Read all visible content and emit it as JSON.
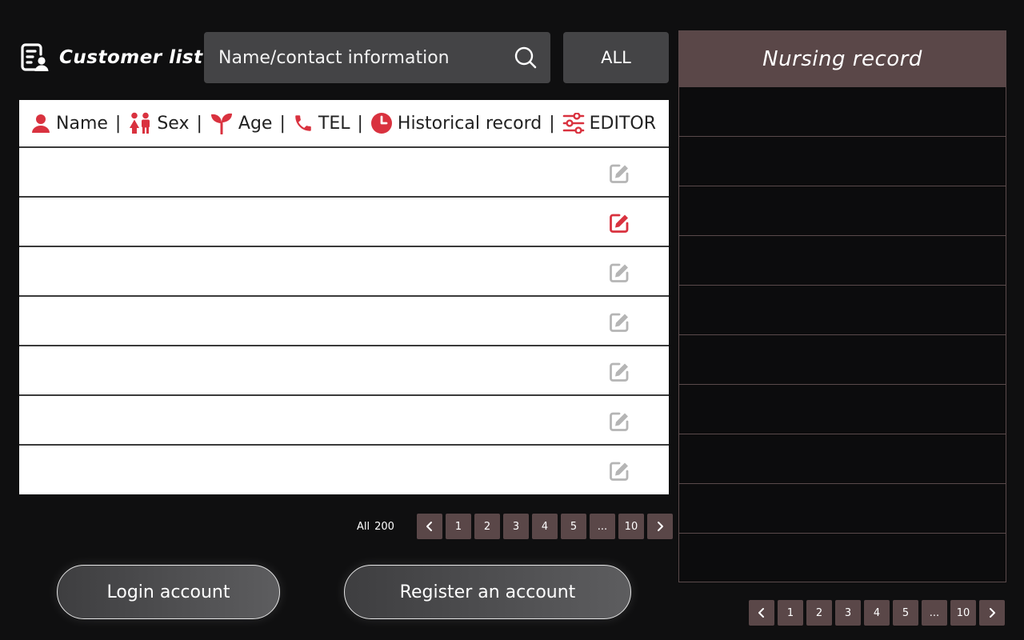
{
  "header": {
    "title": "Customer list",
    "title_icon": "customer-list-icon"
  },
  "search": {
    "placeholder": "Name/contact information",
    "value": ""
  },
  "filter": {
    "label": "ALL"
  },
  "table": {
    "columns": [
      {
        "label": "Name",
        "icon": "person-icon"
      },
      {
        "label": "Sex",
        "icon": "couple-icon"
      },
      {
        "label": "Age",
        "icon": "sprout-icon"
      },
      {
        "label": "TEL",
        "icon": "phone-icon"
      },
      {
        "label": "Historical record",
        "icon": "clock-icon"
      },
      {
        "label": "EDITOR",
        "icon": "sliders-icon"
      }
    ],
    "rows": [
      {
        "edit_active": false
      },
      {
        "edit_active": true
      },
      {
        "edit_active": false
      },
      {
        "edit_active": false
      },
      {
        "edit_active": false
      },
      {
        "edit_active": false
      },
      {
        "edit_active": false
      }
    ]
  },
  "pagination": {
    "total_label": "All",
    "total_count": "200",
    "pages": [
      "1",
      "2",
      "3",
      "4",
      "5",
      "...",
      "10"
    ]
  },
  "buttons": {
    "login": "Login account",
    "register": "Register an account"
  },
  "nursing": {
    "title": "Nursing record",
    "row_count": 10,
    "pages": [
      "1",
      "2",
      "3",
      "4",
      "5",
      "...",
      "10"
    ]
  },
  "colors": {
    "accent": "#d9323f",
    "pager_bg": "#5a4748",
    "edit_inactive": "#b5b5b5",
    "field_bg": "#444446"
  }
}
